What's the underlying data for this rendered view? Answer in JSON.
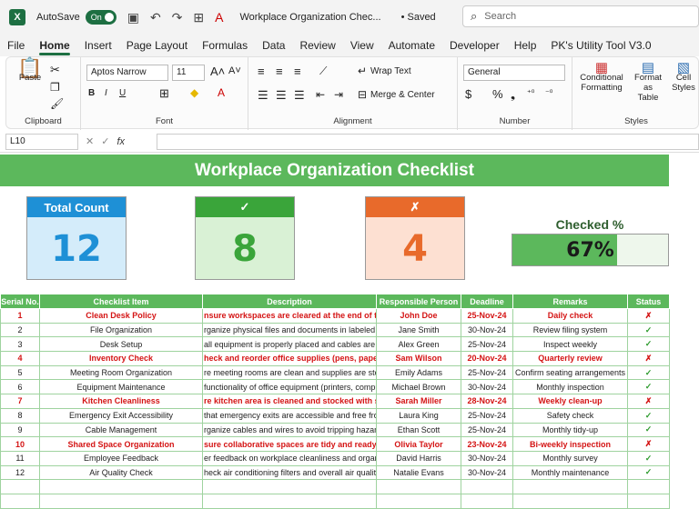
{
  "titlebar": {
    "logo": "X",
    "autosave_label": "AutoSave",
    "autosave_state": "On",
    "doc_title": "Workplace Organization Chec...",
    "saved": "• Saved",
    "search_placeholder": "Search"
  },
  "menu": [
    "File",
    "Home",
    "Insert",
    "Page Layout",
    "Formulas",
    "Data",
    "Review",
    "View",
    "Automate",
    "Developer",
    "Help",
    "PK's Utility Tool V3.0"
  ],
  "ribbon": {
    "clipboard": {
      "paste": "Paste",
      "label": "Clipboard"
    },
    "font": {
      "name": "Aptos Narrow",
      "size": "11",
      "label": "Font"
    },
    "alignment": {
      "wrap": "Wrap Text",
      "merge": "Merge & Center",
      "label": "Alignment"
    },
    "number": {
      "format": "General",
      "label": "Number"
    },
    "styles": {
      "conditional": "Conditional",
      "conditional2": "Formatting",
      "format_table": "Format as",
      "format_table2": "Table",
      "cell": "Cell",
      "cell2": "Styles",
      "label": "Styles"
    }
  },
  "formula_bar": {
    "name_box": "L10",
    "fx": "fx"
  },
  "sheet": {
    "title": "Workplace Organization Checklist",
    "total_label": "Total Count",
    "total_value": "12",
    "checked_label": "✓",
    "checked_value": "8",
    "unchecked_label": "✗",
    "unchecked_value": "4",
    "pct_label": "Checked %",
    "pct_value": "67%",
    "pct_fraction": 0.67,
    "headers": [
      "Serial No.",
      "Checklist Item",
      "Description",
      "Responsible Person",
      "Deadline",
      "Remarks",
      "Status"
    ],
    "rows": [
      {
        "no": "1",
        "item": "Clean Desk Policy",
        "desc": "nsure workspaces are cleared at the end of the da",
        "person": "John Doe",
        "deadline": "25-Nov-24",
        "remarks": "Daily check",
        "status": "✗"
      },
      {
        "no": "2",
        "item": "File Organization",
        "desc": "rganize physical files and documents in labeled fold",
        "person": "Jane Smith",
        "deadline": "30-Nov-24",
        "remarks": "Review filing system",
        "status": "✓"
      },
      {
        "no": "3",
        "item": "Desk Setup",
        "desc": "all equipment is properly placed and cables are m",
        "person": "Alex Green",
        "deadline": "25-Nov-24",
        "remarks": "Inspect weekly",
        "status": "✓"
      },
      {
        "no": "4",
        "item": "Inventory Check",
        "desc": "heck and reorder office supplies (pens, paper, etc",
        "person": "Sam Wilson",
        "deadline": "20-Nov-24",
        "remarks": "Quarterly review",
        "status": "✗"
      },
      {
        "no": "5",
        "item": "Meeting Room Organization",
        "desc": "re meeting rooms are clean and supplies are stoc",
        "person": "Emily Adams",
        "deadline": "25-Nov-24",
        "remarks": "Confirm seating arrangements",
        "status": "✓"
      },
      {
        "no": "6",
        "item": "Equipment Maintenance",
        "desc": " functionality of office equipment (printers, comput",
        "person": "Michael Brown",
        "deadline": "30-Nov-24",
        "remarks": "Monthly inspection",
        "status": "✓"
      },
      {
        "no": "7",
        "item": "Kitchen Cleanliness",
        "desc": "re kitchen area is cleaned and stocked with supp",
        "person": "Sarah Miller",
        "deadline": "28-Nov-24",
        "remarks": "Weekly clean-up",
        "status": "✗"
      },
      {
        "no": "8",
        "item": "Emergency Exit Accessibility",
        "desc": "that emergency exits are accessible and free from c",
        "person": "Laura King",
        "deadline": "25-Nov-24",
        "remarks": "Safety check",
        "status": "✓"
      },
      {
        "no": "9",
        "item": "Cable Management",
        "desc": "rganize cables and wires to avoid tripping hazard",
        "person": "Ethan Scott",
        "deadline": "25-Nov-24",
        "remarks": "Monthly tidy-up",
        "status": "✓"
      },
      {
        "no": "10",
        "item": "Shared Space Organization",
        "desc": "sure collaborative spaces are tidy and ready for u",
        "person": "Olivia Taylor",
        "deadline": "23-Nov-24",
        "remarks": "Bi-weekly inspection",
        "status": "✗"
      },
      {
        "no": "11",
        "item": "Employee Feedback",
        "desc": "er feedback on workplace cleanliness and organiz",
        "person": "David Harris",
        "deadline": "30-Nov-24",
        "remarks": "Monthly survey",
        "status": "✓"
      },
      {
        "no": "12",
        "item": "Air Quality Check",
        "desc": "heck air conditioning filters and overall air quality",
        "person": "Natalie Evans",
        "deadline": "30-Nov-24",
        "remarks": "Monthly maintenance",
        "status": "✓"
      }
    ]
  },
  "colors": {
    "banner": "#5cb85c",
    "total": "#1e90d6",
    "checked": "#3aa53a",
    "unchecked": "#e86a2b"
  }
}
